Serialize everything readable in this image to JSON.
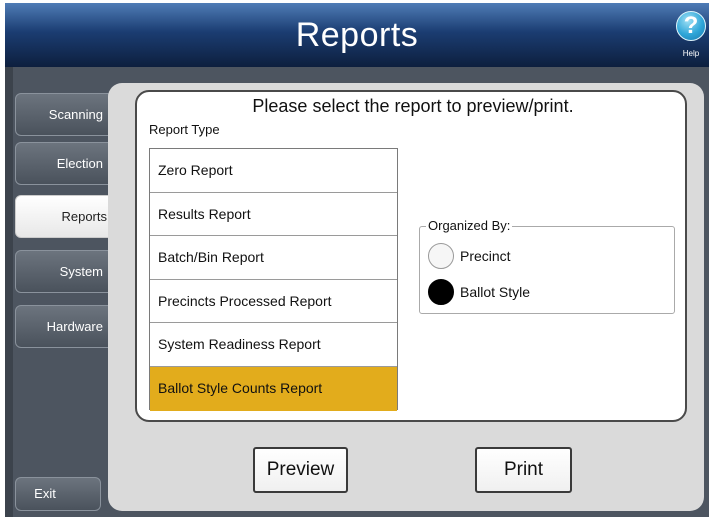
{
  "header": {
    "title": "Reports",
    "help_symbol": "?",
    "help_label": "Help"
  },
  "sidebar": {
    "items": [
      {
        "label": "Scanning"
      },
      {
        "label": "Election"
      },
      {
        "label": "Reports"
      },
      {
        "label": "System"
      },
      {
        "label": "Hardware"
      }
    ],
    "active": "Reports",
    "exit_label": "Exit"
  },
  "panel": {
    "instructions": "Please select the report to preview/print.",
    "report_type_label": "Report Type",
    "reports": [
      {
        "label": "Zero Report"
      },
      {
        "label": "Results Report"
      },
      {
        "label": "Batch/Bin Report"
      },
      {
        "label": "Precincts Processed Report"
      },
      {
        "label": "System Readiness Report"
      },
      {
        "label": "Ballot Style Counts Report"
      }
    ],
    "selected_report": "Ballot Style Counts Report",
    "organized_by": {
      "legend": "Organized By:",
      "options": [
        {
          "label": "Precinct",
          "checked": false
        },
        {
          "label": "Ballot Style",
          "checked": true
        }
      ]
    }
  },
  "actions": {
    "preview_label": "Preview",
    "print_label": "Print"
  },
  "colors": {
    "header_top": "#4f7cb6",
    "header_bottom": "#0d1f3e",
    "selected_row": "#e2ac1c",
    "help_icon": "#2fa6d8"
  }
}
